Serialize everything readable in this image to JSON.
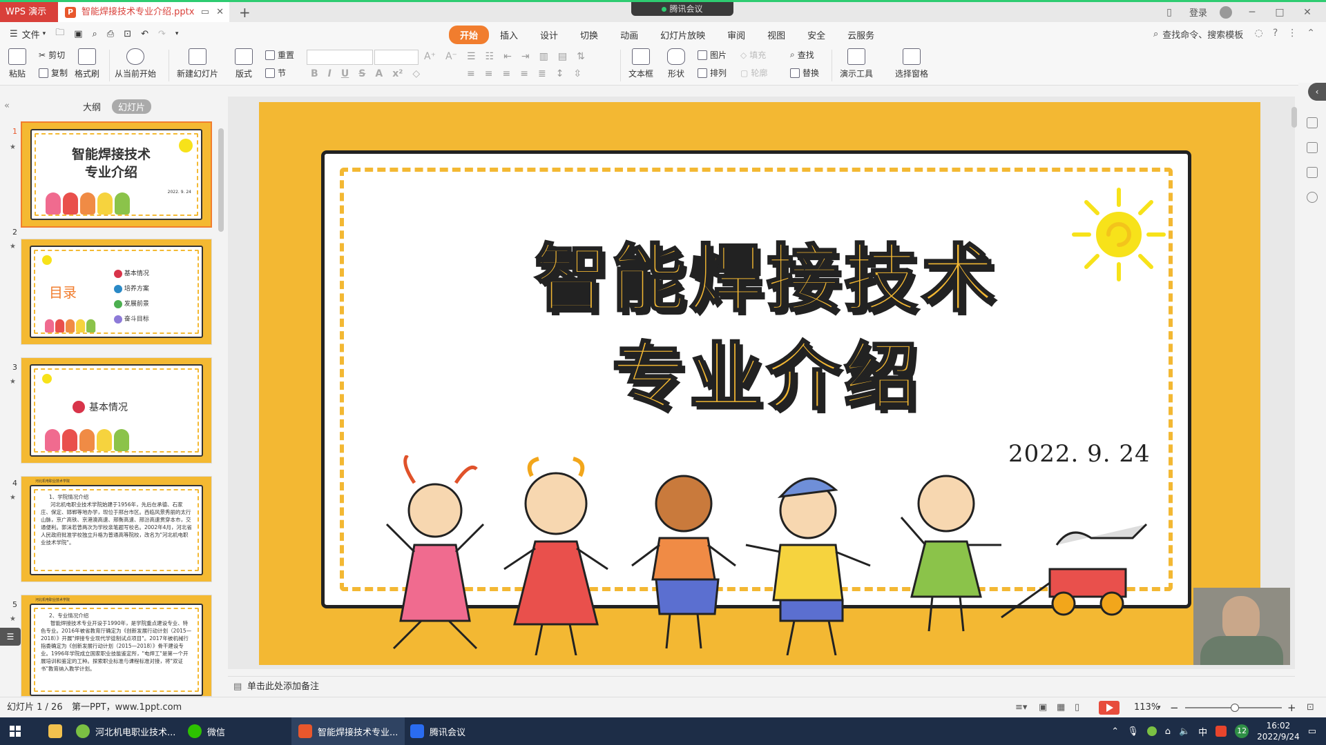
{
  "titlebar": {
    "app_tab": "WPS 演示",
    "doc_tab": "智能焊接技术专业介绍.pptx",
    "ppt_badge": "P",
    "meeting": "腾讯会议",
    "login": "登录"
  },
  "menubar": {
    "file": "文件",
    "tabs": [
      "开始",
      "插入",
      "设计",
      "切换",
      "动画",
      "幻灯片放映",
      "审阅",
      "视图",
      "安全",
      "云服务"
    ],
    "active_tab": "开始",
    "search": "查找命令、搜索模板"
  },
  "ribbon": {
    "paste": "粘贴",
    "cut": "剪切",
    "copy": "复制",
    "format_painter": "格式刷",
    "from_current": "从当前开始",
    "new_slide": "新建幻灯片",
    "layout": "版式",
    "reset": "重置",
    "section": "节",
    "textbox": "文本框",
    "shape": "形状",
    "picture": "图片",
    "arrange": "排列",
    "fill": "填充",
    "outline": "轮廓",
    "find": "查找",
    "replace": "替换",
    "present_tools": "演示工具",
    "select_pane": "选择窗格"
  },
  "panel": {
    "outline_tab": "大纲",
    "slides_tab": "幻灯片",
    "thumbs": [
      {
        "num": "1",
        "title": "智能焊接技术",
        "subtitle": "专业介绍",
        "date": "2022. 9. 24"
      },
      {
        "num": "2",
        "heading": "目录",
        "items": [
          "基本情况",
          "培养方案",
          "发展前景",
          "奋斗目标"
        ]
      },
      {
        "num": "3",
        "heading": "基本情况"
      },
      {
        "num": "4",
        "header": "河北机电职业技术学院",
        "heading": "1、学院情况介绍",
        "body": "河北机电职业技术学院始建于1956年，先后在承德、石家庄、保定、邯郸等地办学，现位于邢台市区。西临风景秀丽的太行山脉，京广高铁、京港澳高速、邢衡高速、邢汾高速贯穿本市，交通便利。郭沫若曾两次为学校亲笔题写校名。2002年4月，河北省人民政府批准学校独立升格为普通高等院校，改名为\"河北机电职业技术学院\"。"
      },
      {
        "num": "5",
        "header": "河北机电职业技术学院",
        "heading": "2、专业情况介绍",
        "body": "智能焊接技术专业开设于1990年，是学院重点建设专业、特色专业。2016年被省教育厅确定为《创新发展行动计划（2015—2018）》开展\"焊接专业现代学徒制试点项目\"。2017年被机械行指委确定为《创新发展行动计划（2015—2018）》骨干建设专业。1996年学院成立国家职业技能鉴定所，\"电焊工\"是第一个开展培训和鉴定的工种。探索职业标准与课程标准对接，将\"双证书\"教育纳入教学计划。"
      }
    ]
  },
  "slide": {
    "title_line1": "智能焊接技术",
    "title_line2": "专业介绍",
    "date": "2022. 9. 24"
  },
  "notes": {
    "placeholder": "单击此处添加备注"
  },
  "status": {
    "slide_counter": "幻灯片 1 / 26",
    "theme": "第一PPT，www.1ppt.com",
    "zoom": "113%"
  },
  "taskbar": {
    "apps": [
      "河北机电职业技术...",
      "微信",
      "智能焊接技术专业...",
      "腾讯会议"
    ],
    "ime": "中",
    "badge": "12",
    "time": "16:02",
    "date": "2022/9/24"
  },
  "colors": {
    "accent": "#f17d2e",
    "slide_bg": "#f3b833",
    "wps_red": "#d9403a"
  }
}
